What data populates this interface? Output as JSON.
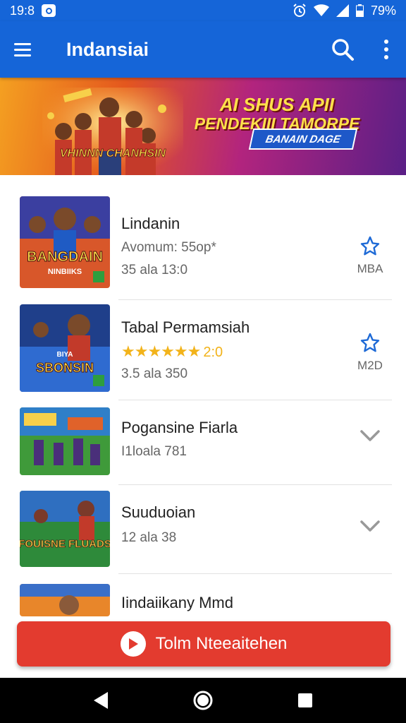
{
  "status_bar": {
    "time": "19:8",
    "battery": "79%"
  },
  "app_bar": {
    "title": "Indansiai"
  },
  "banner": {
    "headline_line1": "AI SHUS APII",
    "headline_line2": "PENDEKIII TAMORPE",
    "ribbon": "BANAIN DAGE",
    "logo_text": "VHINNN CHANHSIN"
  },
  "list": [
    {
      "name": "Lindanin",
      "line2": "Avomum: 55op*",
      "line3": "35 ala 13:0",
      "thumb_text": "BANGDAIN",
      "thumb_sub": "NINBIIKS",
      "action_icon": "star-outline-icon",
      "action_label": "MBA"
    },
    {
      "name": "Tabal Permamsiah",
      "rating": "2:0",
      "line3": "3.5 ala 350",
      "thumb_text": "SBONSIN",
      "thumb_sub": "BIYA",
      "action_icon": "star-outline-icon",
      "action_label": "M2D"
    },
    {
      "name": "Pogansine Fiarla",
      "line2": "I1loala 781",
      "thumb_text": "",
      "action_icon": "chevron-down-icon"
    },
    {
      "name": "Suuduoian",
      "line2": "12 ala 38",
      "thumb_text": "FOUISNE FLUADS",
      "action_icon": "chevron-down-icon"
    },
    {
      "name": "Iindaiikany Mmd"
    }
  ],
  "cta": {
    "label": "Tolm Nteeaitehen"
  },
  "colors": {
    "primary": "#1565d8",
    "accent": "#e33b2f",
    "star": "#f2b31a"
  }
}
